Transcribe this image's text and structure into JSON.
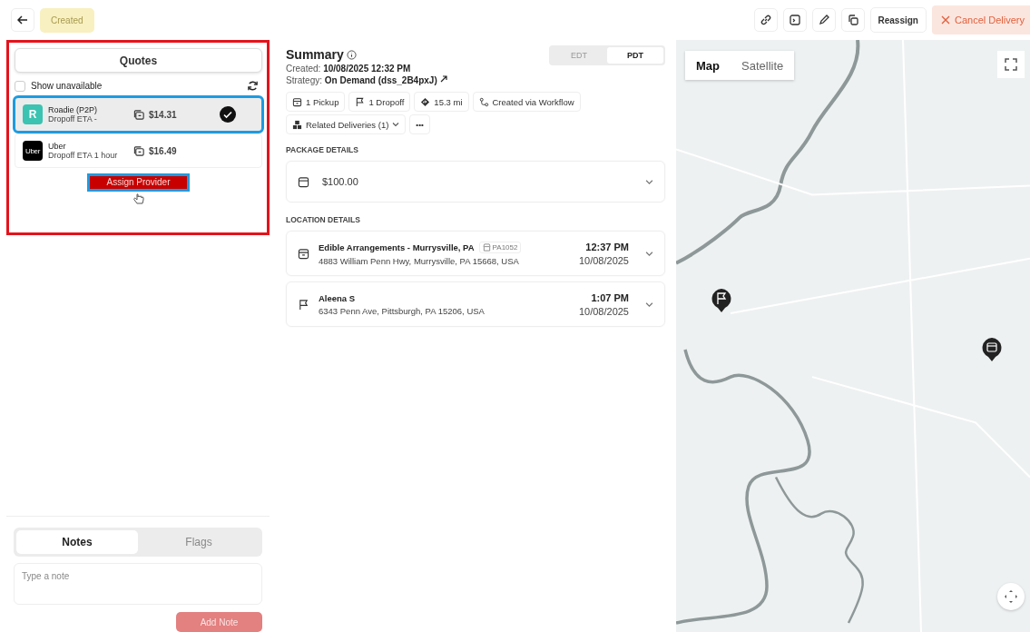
{
  "top_bar": {
    "status": "Created",
    "reassign": "Reassign",
    "cancel": "Cancel Delivery"
  },
  "quotes": {
    "title": "Quotes",
    "show_unavailable": {
      "label": "Show unavailable",
      "checked": false
    },
    "providers": [
      {
        "kind": "roadie",
        "logo_text": "R",
        "name": "Roadie (P2P)",
        "eta": "Dropoff ETA -",
        "price": "$14.31",
        "selected": true
      },
      {
        "kind": "uber",
        "logo_text": "Uber",
        "name": "Uber",
        "eta": "Dropoff ETA 1 hour",
        "price": "$16.49",
        "selected": false
      }
    ],
    "assign_button": "Assign Provider"
  },
  "notes": {
    "tabs": [
      {
        "label": "Notes",
        "selected": true
      },
      {
        "label": "Flags",
        "selected": false
      }
    ],
    "placeholder": "Type a note",
    "add_button": "Add Note"
  },
  "summary": {
    "title": "Summary",
    "created": "Created: **10/08/2025 12:32 PM**",
    "strategy": "Strategy: **On Demand (dss_2B4pxJ)**",
    "timezones": [
      {
        "label": "EDT",
        "selected": false
      },
      {
        "label": "PDT",
        "selected": true
      }
    ],
    "chips": [
      {
        "kind": "pickup",
        "label": "1 Pickup"
      },
      {
        "kind": "dropoff",
        "label": "1 Dropoff"
      },
      {
        "kind": "distance",
        "label": "15.3 mi"
      },
      {
        "kind": "workflow",
        "label": "Created via Workflow"
      },
      {
        "kind": "related",
        "label": "Related Deliveries (1)"
      },
      {
        "kind": "more",
        "label": "•••"
      }
    ]
  },
  "package": {
    "heading": "PACKAGE DETAILS",
    "value": "$100.00"
  },
  "locations": {
    "heading": "LOCATION DETAILS",
    "stops": [
      {
        "kind": "pickup",
        "name": "Edible Arrangements - Murrysville, PA",
        "tag": "PA1052",
        "address": "4883 William Penn Hwy, Murrysville, PA 15668, USA",
        "time": "12:37 PM",
        "date": "10/08/2025"
      },
      {
        "kind": "dropoff",
        "name": "Aleena S",
        "address": "6343 Penn Ave, Pittsburgh, PA 15206, USA",
        "time": "1:07 PM",
        "date": "10/08/2025"
      }
    ]
  },
  "map": {
    "modes": [
      {
        "label": "Map",
        "selected": true
      },
      {
        "label": "Satellite",
        "selected": false
      }
    ]
  }
}
